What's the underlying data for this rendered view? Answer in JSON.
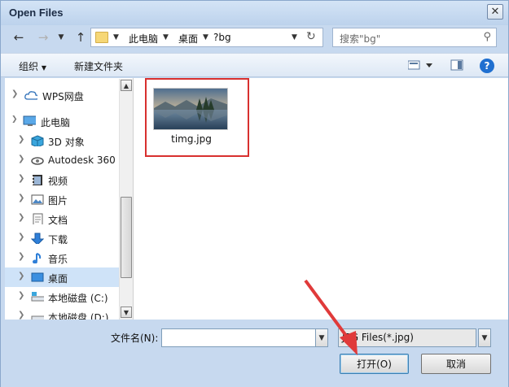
{
  "window": {
    "title": "Open Files"
  },
  "nav": {
    "breadcrumb": [
      "此电脑",
      "桌面",
      "?bg"
    ],
    "search_placeholder": "搜索\"bg\""
  },
  "toolbar": {
    "organize": "组织",
    "new_folder": "新建文件夹"
  },
  "sidebar": {
    "items": [
      {
        "label": "WPS网盘",
        "icon": "cloud-icon"
      },
      {
        "label": "此电脑",
        "icon": "computer-icon"
      },
      {
        "label": "3D 对象",
        "icon": "cube-icon"
      },
      {
        "label": "Autodesk 360",
        "icon": "autodesk-icon"
      },
      {
        "label": "视频",
        "icon": "video-icon"
      },
      {
        "label": "图片",
        "icon": "picture-icon"
      },
      {
        "label": "文档",
        "icon": "document-icon"
      },
      {
        "label": "下载",
        "icon": "download-icon"
      },
      {
        "label": "音乐",
        "icon": "music-icon"
      },
      {
        "label": "桌面",
        "icon": "desktop-icon"
      },
      {
        "label": "本地磁盘 (C:)",
        "icon": "drive-icon"
      },
      {
        "label": "本地磁盘 (D:)",
        "icon": "drive-icon"
      }
    ]
  },
  "files": [
    {
      "name": "timg.jpg"
    }
  ],
  "bottom": {
    "filename_label": "文件名(N):",
    "filename_value": "",
    "filter_value": "JPG Files(*.jpg)",
    "open_label": "打开(O)",
    "cancel_label": "取消"
  },
  "colors": {
    "accent": "#1f6fd0",
    "highlight": "#d8302f",
    "selected": "#cfe3f8"
  }
}
